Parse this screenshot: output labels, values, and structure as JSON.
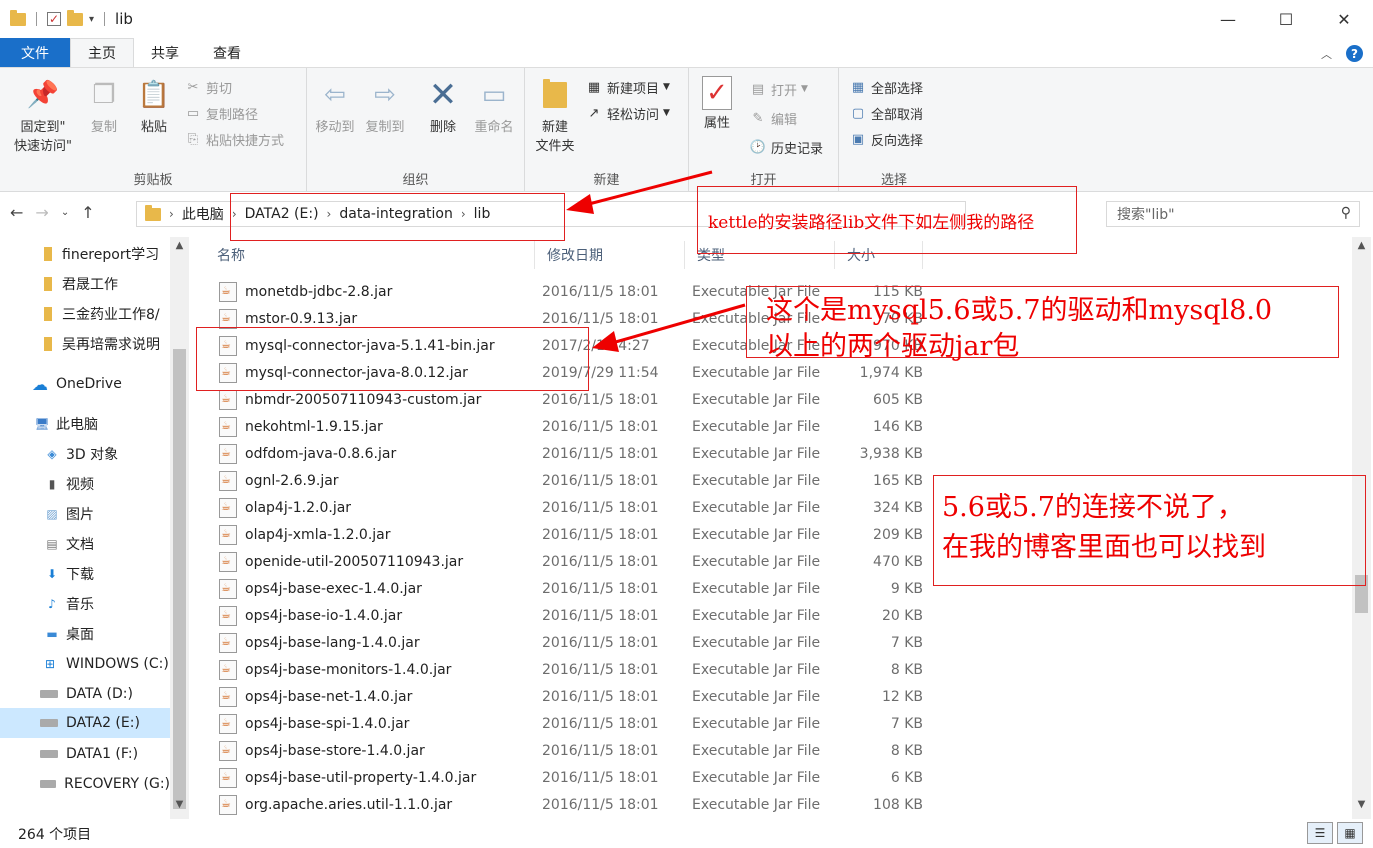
{
  "window": {
    "title": "lib",
    "minimize_icon": "—",
    "maximize_icon": "☐",
    "close_icon": "✕"
  },
  "ribbon_tabs": [
    "文件",
    "主页",
    "共享",
    "查看"
  ],
  "ribbon": {
    "clipboard": {
      "label": "剪贴板",
      "pin_label_1": "固定到\"",
      "pin_label_2": "快速访问\"",
      "copy": "复制",
      "paste": "粘贴",
      "cut": "剪切",
      "copy_path": "复制路径",
      "paste_shortcut": "粘贴快捷方式"
    },
    "organize": {
      "label": "组织",
      "move_to": "移动到",
      "copy_to": "复制到",
      "delete": "删除",
      "rename": "重命名"
    },
    "new": {
      "label": "新建",
      "new_folder_1": "新建",
      "new_folder_2": "文件夹",
      "new_item": "新建项目",
      "easy_access": "轻松访问"
    },
    "open": {
      "label": "打开",
      "properties": "属性",
      "open": "打开",
      "edit": "编辑",
      "history": "历史记录"
    },
    "select": {
      "label": "选择",
      "select_all": "全部选择",
      "select_none": "全部取消",
      "invert": "反向选择"
    }
  },
  "address": {
    "crumbs": [
      "此电脑",
      "DATA2 (E:)",
      "data-integration",
      "lib"
    ],
    "search_placeholder": "搜索\"lib\""
  },
  "sidebar": {
    "items": [
      {
        "label": "finereport学习",
        "kind": "pinned"
      },
      {
        "label": "君晟工作",
        "kind": "pinned"
      },
      {
        "label": "三金药业工作8/",
        "kind": "pinned"
      },
      {
        "label": "吴再培需求说明",
        "kind": "pinned"
      },
      {
        "label": "OneDrive",
        "kind": "cloud"
      },
      {
        "label": "此电脑",
        "kind": "pc"
      },
      {
        "label": "3D 对象",
        "kind": "folder"
      },
      {
        "label": "视频",
        "kind": "folder"
      },
      {
        "label": "图片",
        "kind": "folder"
      },
      {
        "label": "文档",
        "kind": "folder"
      },
      {
        "label": "下载",
        "kind": "folder"
      },
      {
        "label": "音乐",
        "kind": "folder"
      },
      {
        "label": "桌面",
        "kind": "folder"
      },
      {
        "label": "WINDOWS (C:)",
        "kind": "drive"
      },
      {
        "label": "DATA (D:)",
        "kind": "drive"
      },
      {
        "label": "DATA2 (E:)",
        "kind": "drive",
        "selected": true
      },
      {
        "label": "DATA1 (F:)",
        "kind": "drive"
      },
      {
        "label": "RECOVERY (G:)",
        "kind": "drive"
      }
    ]
  },
  "columns": [
    "名称",
    "修改日期",
    "类型",
    "大小"
  ],
  "files": [
    {
      "name": "monetdb-jdbc-2.8.jar",
      "date": "2016/11/5 18:01",
      "type": "Executable Jar File",
      "size": "115 KB"
    },
    {
      "name": "mstor-0.9.13.jar",
      "date": "2016/11/5 18:01",
      "type": "Executable Jar File",
      "size": "70 KB"
    },
    {
      "name": "mysql-connector-java-5.1.41-bin.jar",
      "date": "2017/2/13 4:27",
      "type": "Executable Jar File",
      "size": "970 KB"
    },
    {
      "name": "mysql-connector-java-8.0.12.jar",
      "date": "2019/7/29 11:54",
      "type": "Executable Jar File",
      "size": "1,974 KB"
    },
    {
      "name": "nbmdr-200507110943-custom.jar",
      "date": "2016/11/5 18:01",
      "type": "Executable Jar File",
      "size": "605 KB"
    },
    {
      "name": "nekohtml-1.9.15.jar",
      "date": "2016/11/5 18:01",
      "type": "Executable Jar File",
      "size": "146 KB"
    },
    {
      "name": "odfdom-java-0.8.6.jar",
      "date": "2016/11/5 18:01",
      "type": "Executable Jar File",
      "size": "3,938 KB"
    },
    {
      "name": "ognl-2.6.9.jar",
      "date": "2016/11/5 18:01",
      "type": "Executable Jar File",
      "size": "165 KB"
    },
    {
      "name": "olap4j-1.2.0.jar",
      "date": "2016/11/5 18:01",
      "type": "Executable Jar File",
      "size": "324 KB"
    },
    {
      "name": "olap4j-xmla-1.2.0.jar",
      "date": "2016/11/5 18:01",
      "type": "Executable Jar File",
      "size": "209 KB"
    },
    {
      "name": "openide-util-200507110943.jar",
      "date": "2016/11/5 18:01",
      "type": "Executable Jar File",
      "size": "470 KB"
    },
    {
      "name": "ops4j-base-exec-1.4.0.jar",
      "date": "2016/11/5 18:01",
      "type": "Executable Jar File",
      "size": "9 KB"
    },
    {
      "name": "ops4j-base-io-1.4.0.jar",
      "date": "2016/11/5 18:01",
      "type": "Executable Jar File",
      "size": "20 KB"
    },
    {
      "name": "ops4j-base-lang-1.4.0.jar",
      "date": "2016/11/5 18:01",
      "type": "Executable Jar File",
      "size": "7 KB"
    },
    {
      "name": "ops4j-base-monitors-1.4.0.jar",
      "date": "2016/11/5 18:01",
      "type": "Executable Jar File",
      "size": "8 KB"
    },
    {
      "name": "ops4j-base-net-1.4.0.jar",
      "date": "2016/11/5 18:01",
      "type": "Executable Jar File",
      "size": "12 KB"
    },
    {
      "name": "ops4j-base-spi-1.4.0.jar",
      "date": "2016/11/5 18:01",
      "type": "Executable Jar File",
      "size": "7 KB"
    },
    {
      "name": "ops4j-base-store-1.4.0.jar",
      "date": "2016/11/5 18:01",
      "type": "Executable Jar File",
      "size": "8 KB"
    },
    {
      "name": "ops4j-base-util-property-1.4.0.jar",
      "date": "2016/11/5 18:01",
      "type": "Executable Jar File",
      "size": "6 KB"
    },
    {
      "name": "org.apache.aries.util-1.1.0.jar",
      "date": "2016/11/5 18:01",
      "type": "Executable Jar File",
      "size": "108 KB"
    }
  ],
  "status": {
    "count": "264 个项目"
  },
  "annotations": {
    "path_note": "kettle的安装路径lib文件下如左侧我的路径",
    "driver_note_1": "这个是mysql5.6或5.7的驱动和mysql8.0",
    "driver_note_2": "以上的两个驱动jar包",
    "blog_note_1": "5.6或5.7的连接不说了，",
    "blog_note_2": "在我的博客里面也可以找到",
    "color": "#ee0000"
  }
}
